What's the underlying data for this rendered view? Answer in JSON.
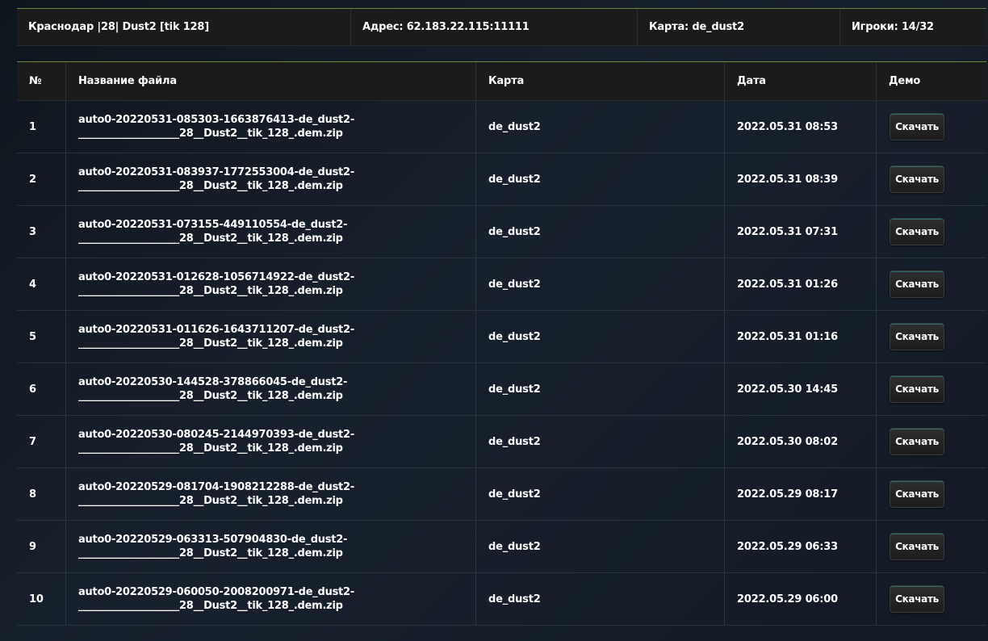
{
  "server": {
    "name": "Краснодар |28| Dust2 [tik 128]",
    "address": "Адрес: 62.183.22.115:11111",
    "map": "Карта: de_dust2",
    "players": "Игроки: 14/32"
  },
  "table": {
    "headers": {
      "num": "№",
      "file": "Название файла",
      "map": "Карта",
      "date": "Дата",
      "demo": "Демо"
    },
    "download_label": "Скачать",
    "rows": [
      {
        "num": "1",
        "file": "auto0-20220531-085303-1663876413-de_dust2-\n____________________28__Dust2__tik_128_.dem.zip",
        "map": "de_dust2",
        "date": "2022.05.31 08:53"
      },
      {
        "num": "2",
        "file": "auto0-20220531-083937-1772553004-de_dust2-\n____________________28__Dust2__tik_128_.dem.zip",
        "map": "de_dust2",
        "date": "2022.05.31 08:39"
      },
      {
        "num": "3",
        "file": "auto0-20220531-073155-449110554-de_dust2-\n____________________28__Dust2__tik_128_.dem.zip",
        "map": "de_dust2",
        "date": "2022.05.31 07:31"
      },
      {
        "num": "4",
        "file": "auto0-20220531-012628-1056714922-de_dust2-\n____________________28__Dust2__tik_128_.dem.zip",
        "map": "de_dust2",
        "date": "2022.05.31 01:26"
      },
      {
        "num": "5",
        "file": "auto0-20220531-011626-1643711207-de_dust2-\n____________________28__Dust2__tik_128_.dem.zip",
        "map": "de_dust2",
        "date": "2022.05.31 01:16"
      },
      {
        "num": "6",
        "file": "auto0-20220530-144528-378866045-de_dust2-\n____________________28__Dust2__tik_128_.dem.zip",
        "map": "de_dust2",
        "date": "2022.05.30 14:45"
      },
      {
        "num": "7",
        "file": "auto0-20220530-080245-2144970393-de_dust2-\n____________________28__Dust2__tik_128_.dem.zip",
        "map": "de_dust2",
        "date": "2022.05.30 08:02"
      },
      {
        "num": "8",
        "file": "auto0-20220529-081704-1908212288-de_dust2-\n____________________28__Dust2__tik_128_.dem.zip",
        "map": "de_dust2",
        "date": "2022.05.29 08:17"
      },
      {
        "num": "9",
        "file": "auto0-20220529-063313-507904830-de_dust2-\n____________________28__Dust2__tik_128_.dem.zip",
        "map": "de_dust2",
        "date": "2022.05.29 06:33"
      },
      {
        "num": "10",
        "file": "auto0-20220529-060050-2008200971-de_dust2-\n____________________28__Dust2__tik_128_.dem.zip",
        "map": "de_dust2",
        "date": "2022.05.29 06:00"
      }
    ]
  }
}
